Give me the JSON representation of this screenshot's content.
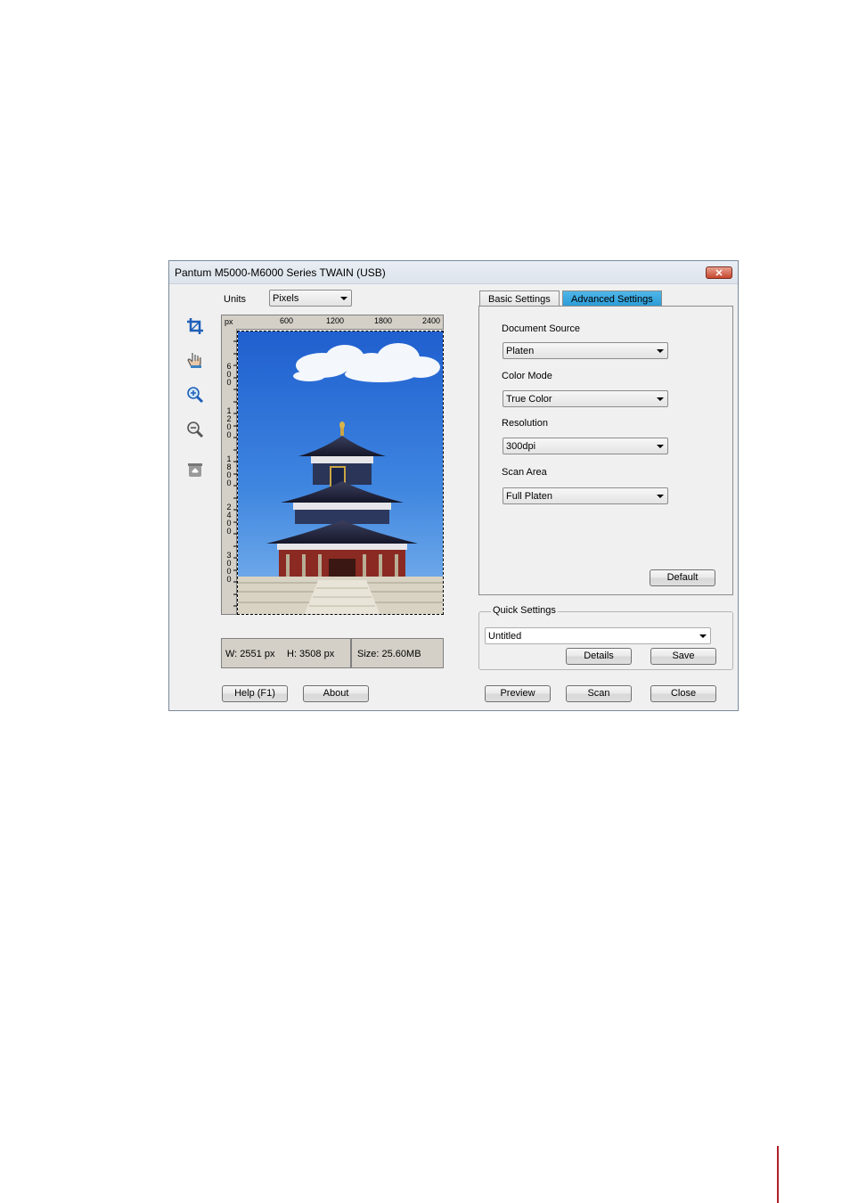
{
  "window": {
    "title": "Pantum M5000-M6000 Series TWAIN (USB)",
    "close_glyph": "✕"
  },
  "units": {
    "label": "Units",
    "value": "Pixels"
  },
  "toolbar": {
    "icons": [
      "crop-icon",
      "hand-icon",
      "zoom-in-icon",
      "zoom-out-icon",
      "eject-icon"
    ]
  },
  "ruler": {
    "unit": "px",
    "top_ticks": [
      "600",
      "1200",
      "1800",
      "2400"
    ],
    "left_ticks": [
      "600",
      "1200",
      "1800",
      "2400",
      "3000"
    ]
  },
  "status": {
    "width": "W:  2551 px",
    "height": "H:  3508 px",
    "size": "Size: 25.60MB"
  },
  "tabs": [
    {
      "label": "Basic Settings",
      "active": false
    },
    {
      "label": "Advanced Settings",
      "active": true
    }
  ],
  "settings": {
    "document_source": {
      "label": "Document Source",
      "value": "Platen"
    },
    "color_mode": {
      "label": "Color Mode",
      "value": "True Color"
    },
    "resolution": {
      "label": "Resolution",
      "value": "300dpi"
    },
    "scan_area": {
      "label": "Scan Area",
      "value": "Full Platen"
    },
    "default_button": "Default"
  },
  "quick_settings": {
    "title": "Quick Settings",
    "value": "Untitled",
    "details_button": "Details",
    "save_button": "Save"
  },
  "footer": {
    "help_button": "Help (F1)",
    "about_button": "About",
    "preview_button": "Preview",
    "scan_button": "Scan",
    "close_button": "Close"
  },
  "colors": {
    "active_tab": "#2a9bd6",
    "sky": "#2f6fd8",
    "margin_rule": "#b01e2a"
  }
}
